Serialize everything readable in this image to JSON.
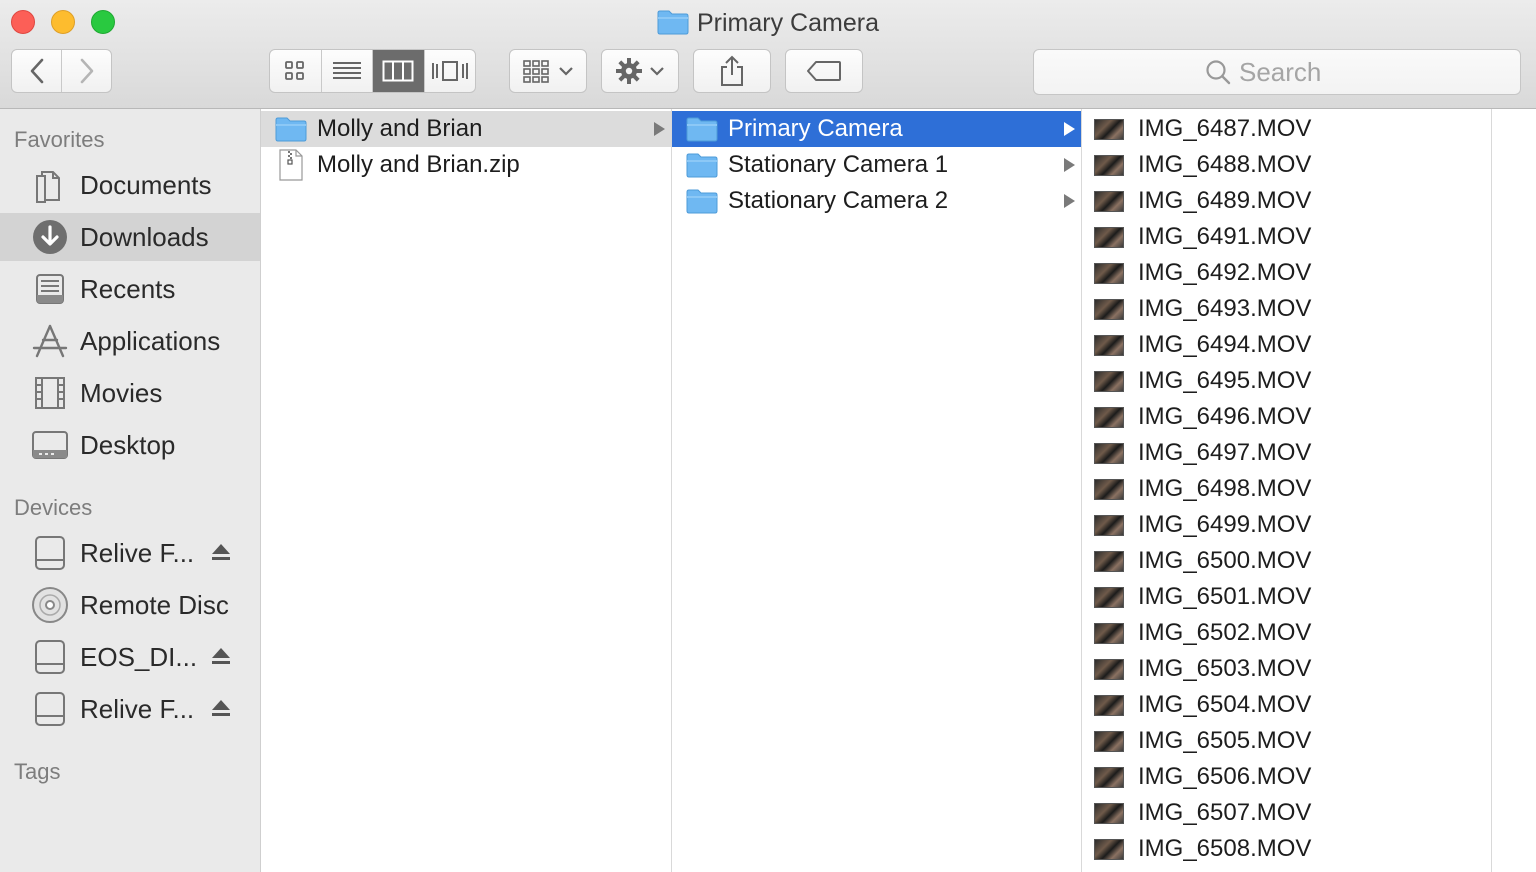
{
  "window": {
    "title": "Primary Camera"
  },
  "toolbar": {
    "back_label": "Back",
    "forward_label": "Forward",
    "search_placeholder": "Search"
  },
  "sidebar": {
    "favorites_header": "Favorites",
    "favorites": [
      {
        "label": "Documents",
        "icon": "documents-icon"
      },
      {
        "label": "Downloads",
        "icon": "downloads-icon",
        "selected": true
      },
      {
        "label": "Recents",
        "icon": "recents-icon"
      },
      {
        "label": "Applications",
        "icon": "applications-icon"
      },
      {
        "label": "Movies",
        "icon": "movies-icon"
      },
      {
        "label": "Desktop",
        "icon": "desktop-icon"
      }
    ],
    "devices_header": "Devices",
    "devices": [
      {
        "label": "Relive F...",
        "icon": "drive-icon",
        "eject": true
      },
      {
        "label": "Remote Disc",
        "icon": "disc-icon",
        "eject": false
      },
      {
        "label": "EOS_DI...",
        "icon": "drive-icon",
        "eject": true
      },
      {
        "label": "Relive F...",
        "icon": "drive-icon",
        "eject": true
      }
    ],
    "tags_header": "Tags"
  },
  "columns": {
    "col1": [
      {
        "label": "Molly and Brian",
        "type": "folder",
        "selected": true,
        "arrow": true
      },
      {
        "label": "Molly and Brian.zip",
        "type": "zip",
        "selected": false,
        "arrow": false
      }
    ],
    "col2": [
      {
        "label": "Primary Camera",
        "type": "folder",
        "selected": true,
        "arrow": true
      },
      {
        "label": "Stationary Camera 1",
        "type": "folder",
        "selected": false,
        "arrow": true
      },
      {
        "label": "Stationary Camera 2",
        "type": "folder",
        "selected": false,
        "arrow": true
      }
    ],
    "col3": [
      "IMG_6487.MOV",
      "IMG_6488.MOV",
      "IMG_6489.MOV",
      "IMG_6491.MOV",
      "IMG_6492.MOV",
      "IMG_6493.MOV",
      "IMG_6494.MOV",
      "IMG_6495.MOV",
      "IMG_6496.MOV",
      "IMG_6497.MOV",
      "IMG_6498.MOV",
      "IMG_6499.MOV",
      "IMG_6500.MOV",
      "IMG_6501.MOV",
      "IMG_6502.MOV",
      "IMG_6503.MOV",
      "IMG_6504.MOV",
      "IMG_6505.MOV",
      "IMG_6506.MOV",
      "IMG_6507.MOV",
      "IMG_6508.MOV"
    ]
  },
  "colors": {
    "selection_blue": "#2e6fd7",
    "folder_blue": "#6fb8f2",
    "close": "#fc5f57",
    "minimize": "#fdbc2e",
    "zoom": "#29c940"
  }
}
